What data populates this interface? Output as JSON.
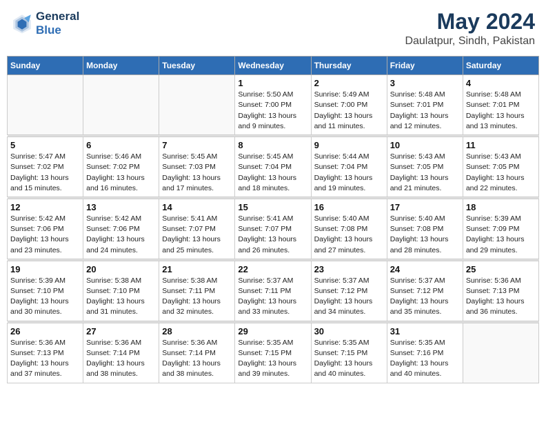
{
  "header": {
    "logo_line1": "General",
    "logo_line2": "Blue",
    "main_title": "May 2024",
    "subtitle": "Daulatpur, Sindh, Pakistan"
  },
  "weekdays": [
    "Sunday",
    "Monday",
    "Tuesday",
    "Wednesday",
    "Thursday",
    "Friday",
    "Saturday"
  ],
  "weeks": [
    [
      {
        "day": "",
        "info": ""
      },
      {
        "day": "",
        "info": ""
      },
      {
        "day": "",
        "info": ""
      },
      {
        "day": "1",
        "info": "Sunrise: 5:50 AM\nSunset: 7:00 PM\nDaylight: 13 hours\nand 9 minutes."
      },
      {
        "day": "2",
        "info": "Sunrise: 5:49 AM\nSunset: 7:00 PM\nDaylight: 13 hours\nand 11 minutes."
      },
      {
        "day": "3",
        "info": "Sunrise: 5:48 AM\nSunset: 7:01 PM\nDaylight: 13 hours\nand 12 minutes."
      },
      {
        "day": "4",
        "info": "Sunrise: 5:48 AM\nSunset: 7:01 PM\nDaylight: 13 hours\nand 13 minutes."
      }
    ],
    [
      {
        "day": "5",
        "info": "Sunrise: 5:47 AM\nSunset: 7:02 PM\nDaylight: 13 hours\nand 15 minutes."
      },
      {
        "day": "6",
        "info": "Sunrise: 5:46 AM\nSunset: 7:02 PM\nDaylight: 13 hours\nand 16 minutes."
      },
      {
        "day": "7",
        "info": "Sunrise: 5:45 AM\nSunset: 7:03 PM\nDaylight: 13 hours\nand 17 minutes."
      },
      {
        "day": "8",
        "info": "Sunrise: 5:45 AM\nSunset: 7:04 PM\nDaylight: 13 hours\nand 18 minutes."
      },
      {
        "day": "9",
        "info": "Sunrise: 5:44 AM\nSunset: 7:04 PM\nDaylight: 13 hours\nand 19 minutes."
      },
      {
        "day": "10",
        "info": "Sunrise: 5:43 AM\nSunset: 7:05 PM\nDaylight: 13 hours\nand 21 minutes."
      },
      {
        "day": "11",
        "info": "Sunrise: 5:43 AM\nSunset: 7:05 PM\nDaylight: 13 hours\nand 22 minutes."
      }
    ],
    [
      {
        "day": "12",
        "info": "Sunrise: 5:42 AM\nSunset: 7:06 PM\nDaylight: 13 hours\nand 23 minutes."
      },
      {
        "day": "13",
        "info": "Sunrise: 5:42 AM\nSunset: 7:06 PM\nDaylight: 13 hours\nand 24 minutes."
      },
      {
        "day": "14",
        "info": "Sunrise: 5:41 AM\nSunset: 7:07 PM\nDaylight: 13 hours\nand 25 minutes."
      },
      {
        "day": "15",
        "info": "Sunrise: 5:41 AM\nSunset: 7:07 PM\nDaylight: 13 hours\nand 26 minutes."
      },
      {
        "day": "16",
        "info": "Sunrise: 5:40 AM\nSunset: 7:08 PM\nDaylight: 13 hours\nand 27 minutes."
      },
      {
        "day": "17",
        "info": "Sunrise: 5:40 AM\nSunset: 7:08 PM\nDaylight: 13 hours\nand 28 minutes."
      },
      {
        "day": "18",
        "info": "Sunrise: 5:39 AM\nSunset: 7:09 PM\nDaylight: 13 hours\nand 29 minutes."
      }
    ],
    [
      {
        "day": "19",
        "info": "Sunrise: 5:39 AM\nSunset: 7:10 PM\nDaylight: 13 hours\nand 30 minutes."
      },
      {
        "day": "20",
        "info": "Sunrise: 5:38 AM\nSunset: 7:10 PM\nDaylight: 13 hours\nand 31 minutes."
      },
      {
        "day": "21",
        "info": "Sunrise: 5:38 AM\nSunset: 7:11 PM\nDaylight: 13 hours\nand 32 minutes."
      },
      {
        "day": "22",
        "info": "Sunrise: 5:37 AM\nSunset: 7:11 PM\nDaylight: 13 hours\nand 33 minutes."
      },
      {
        "day": "23",
        "info": "Sunrise: 5:37 AM\nSunset: 7:12 PM\nDaylight: 13 hours\nand 34 minutes."
      },
      {
        "day": "24",
        "info": "Sunrise: 5:37 AM\nSunset: 7:12 PM\nDaylight: 13 hours\nand 35 minutes."
      },
      {
        "day": "25",
        "info": "Sunrise: 5:36 AM\nSunset: 7:13 PM\nDaylight: 13 hours\nand 36 minutes."
      }
    ],
    [
      {
        "day": "26",
        "info": "Sunrise: 5:36 AM\nSunset: 7:13 PM\nDaylight: 13 hours\nand 37 minutes."
      },
      {
        "day": "27",
        "info": "Sunrise: 5:36 AM\nSunset: 7:14 PM\nDaylight: 13 hours\nand 38 minutes."
      },
      {
        "day": "28",
        "info": "Sunrise: 5:36 AM\nSunset: 7:14 PM\nDaylight: 13 hours\nand 38 minutes."
      },
      {
        "day": "29",
        "info": "Sunrise: 5:35 AM\nSunset: 7:15 PM\nDaylight: 13 hours\nand 39 minutes."
      },
      {
        "day": "30",
        "info": "Sunrise: 5:35 AM\nSunset: 7:15 PM\nDaylight: 13 hours\nand 40 minutes."
      },
      {
        "day": "31",
        "info": "Sunrise: 5:35 AM\nSunset: 7:16 PM\nDaylight: 13 hours\nand 40 minutes."
      },
      {
        "day": "",
        "info": ""
      }
    ]
  ]
}
